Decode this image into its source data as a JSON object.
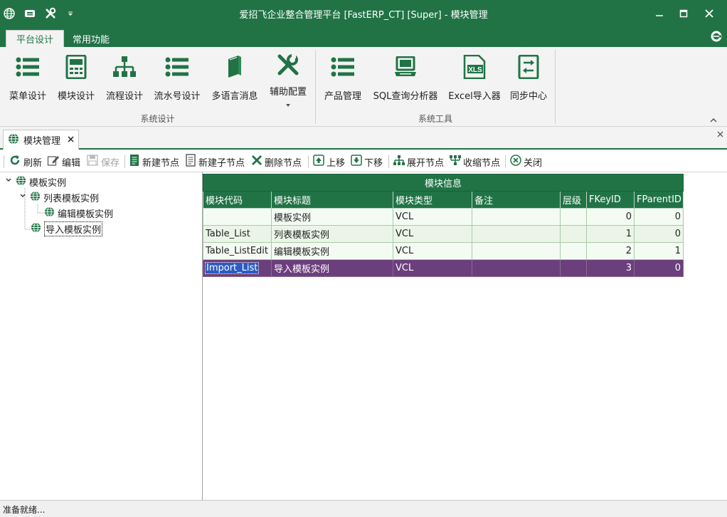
{
  "titlebar": {
    "title": "爱招飞企业整合管理平台 [FastERP_CT] [Super] - 模块管理",
    "quick_access": [
      "globe-icon",
      "save-icon",
      "tools-icon",
      "dropdown-arrow-icon"
    ],
    "window_buttons": [
      "minimize-icon",
      "maximize-icon",
      "close-icon"
    ],
    "help_icon": "help-icon"
  },
  "ribbon_tabs": [
    {
      "label": "平台设计",
      "active": true
    },
    {
      "label": "常用功能",
      "active": false
    }
  ],
  "ribbon": {
    "groups": [
      {
        "label": "系统设计",
        "buttons": [
          {
            "label": "菜单设计",
            "icon": "list-icon"
          },
          {
            "label": "模块设计",
            "icon": "module-icon"
          },
          {
            "label": "流程设计",
            "icon": "flowchart-icon"
          },
          {
            "label": "流水号设计",
            "icon": "list-icon"
          },
          {
            "label": "多语言消息",
            "icon": "book-icon"
          },
          {
            "label": "辅助配置",
            "icon": "tools-icon",
            "has_dropdown": true
          }
        ]
      },
      {
        "label": "系统工具",
        "buttons": [
          {
            "label": "产品管理",
            "icon": "list-icon"
          },
          {
            "label": "SQL查询分析器",
            "icon": "computer-icon"
          },
          {
            "label": "Excel导入器",
            "icon": "xls-icon"
          },
          {
            "label": "同步中心",
            "icon": "sync-icon"
          }
        ]
      }
    ],
    "collapse_icon": "chevron-up-icon"
  },
  "document_tab": {
    "label": "模块管理",
    "icon": "globe-icon",
    "close_icon": "close-icon"
  },
  "toolbar": {
    "refresh": "刷新",
    "edit": "编辑",
    "save": "保存",
    "new_node": "新建节点",
    "new_child_node": "新建子节点",
    "delete_node": "删除节点",
    "move_up": "上移",
    "move_down": "下移",
    "expand_nodes": "展开节点",
    "collapse_nodes": "收缩节点",
    "close": "关闭"
  },
  "tree": {
    "nodes": [
      {
        "label": "模板实例",
        "level": 0,
        "expanded": true
      },
      {
        "label": "列表模板实例",
        "level": 1,
        "expanded": true
      },
      {
        "label": "编辑模板实例",
        "level": 2
      },
      {
        "label": "导入模板实例",
        "level": 1,
        "selected": true
      }
    ]
  },
  "grid": {
    "band_title": "模块信息",
    "columns": [
      "模块代码",
      "模块标题",
      "模块类型",
      "备注",
      "层级",
      "FKeyID",
      "FParentID"
    ],
    "rows": [
      {
        "code": "",
        "title": "模板实例",
        "type": "VCL",
        "note": "",
        "level": "",
        "fkeyid": "0",
        "fparentid": "0"
      },
      {
        "code": "Table_List",
        "title": "列表模板实例",
        "type": "VCL",
        "note": "",
        "level": "",
        "fkeyid": "1",
        "fparentid": "0"
      },
      {
        "code": "Table_ListEdit",
        "title": "编辑模板实例",
        "type": "VCL",
        "note": "",
        "level": "",
        "fkeyid": "2",
        "fparentid": "1"
      },
      {
        "code": "Import_List",
        "title": "导入模板实例",
        "type": "VCL",
        "note": "",
        "level": "",
        "fkeyid": "3",
        "fparentid": "0",
        "selected": true
      }
    ]
  },
  "statusbar": {
    "text": "准备就绪..."
  },
  "colors": {
    "accent": "#217346",
    "selected_row": "#6b3f7c",
    "focus_cell": "#2b5cc4"
  }
}
